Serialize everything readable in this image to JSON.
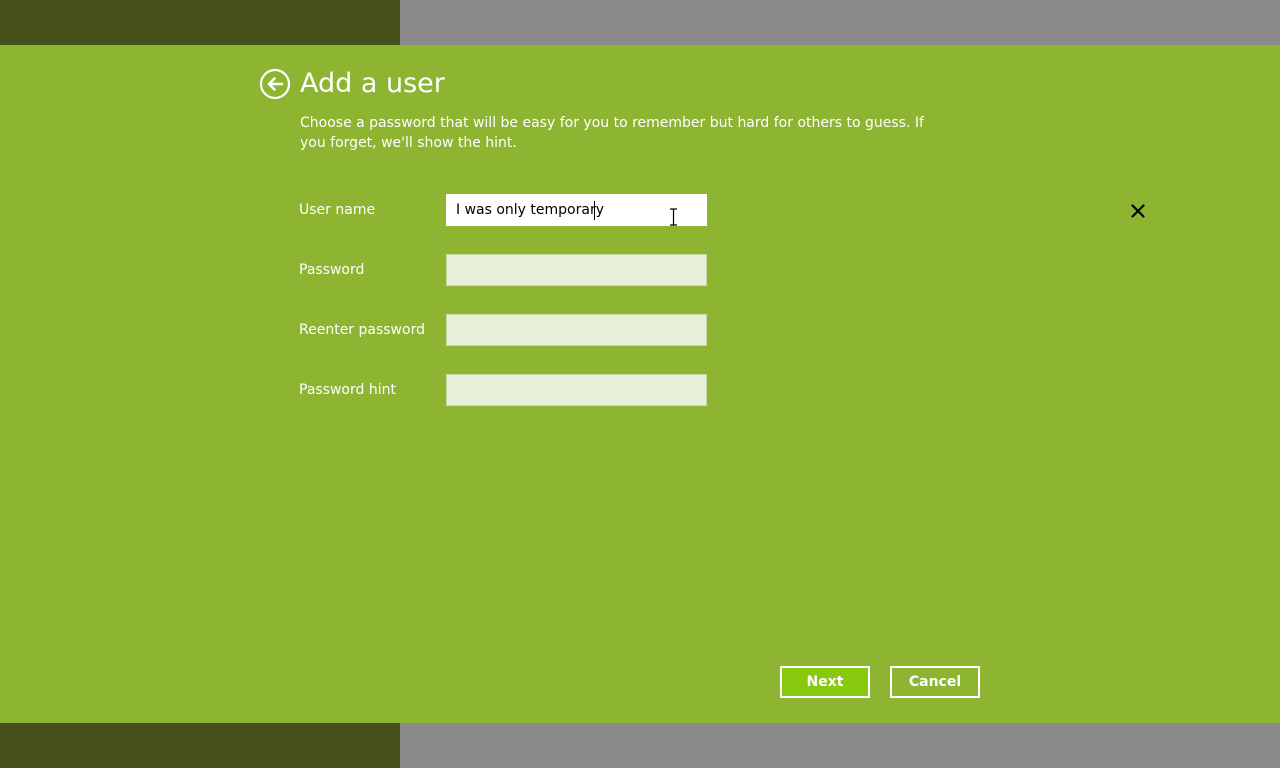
{
  "dialog": {
    "title": "Add a user",
    "description": "Choose a password that will be easy for you to remember but hard for others to guess. If you forget, we'll show the hint."
  },
  "form": {
    "fields": [
      {
        "label": "User name",
        "value": "I was only temporary",
        "active": true
      },
      {
        "label": "Password",
        "value": ""
      },
      {
        "label": "Reenter password",
        "value": ""
      },
      {
        "label": "Password hint",
        "value": ""
      }
    ]
  },
  "buttons": {
    "next_label": "Next",
    "cancel_label": "Cancel"
  },
  "icons": {
    "back": "back-arrow-icon",
    "clear": "close-icon",
    "cursor": "text-cursor-icon"
  },
  "colors": {
    "accent_background": "#8db531",
    "next_button": "#89c90d",
    "dark_band": "#46501b",
    "gray_band": "#8a8a8a",
    "input_inactive": "#e8f0d9"
  }
}
